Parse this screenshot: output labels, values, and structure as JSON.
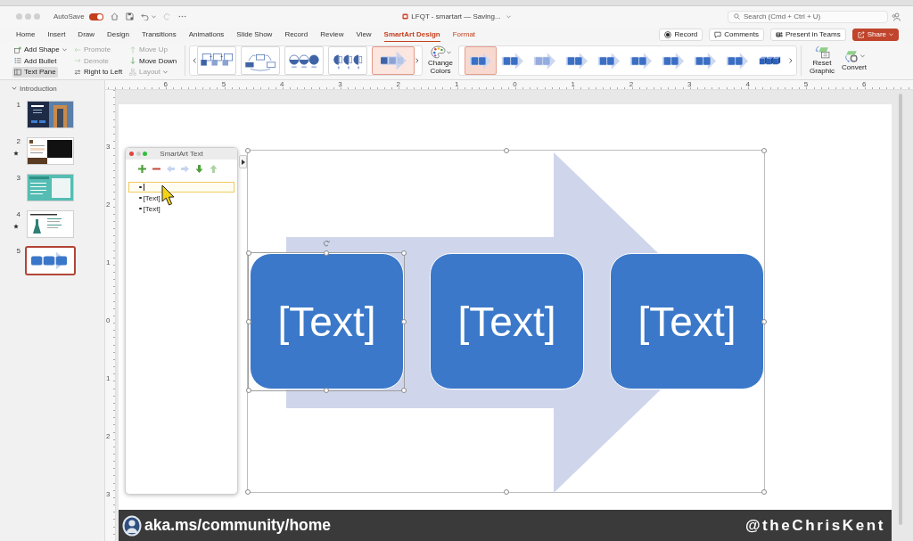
{
  "window": {
    "title": "LFQT - smartart — Saving...",
    "autosave": {
      "label": "AutoSave",
      "on": true
    },
    "search": {
      "placeholder": "Search (Cmd + Ctrl + U)"
    }
  },
  "tabs": [
    {
      "label": "Home",
      "selected": false,
      "contextual": false
    },
    {
      "label": "Insert",
      "selected": false,
      "contextual": false
    },
    {
      "label": "Draw",
      "selected": false,
      "contextual": false
    },
    {
      "label": "Design",
      "selected": false,
      "contextual": false
    },
    {
      "label": "Transitions",
      "selected": false,
      "contextual": false
    },
    {
      "label": "Animations",
      "selected": false,
      "contextual": false
    },
    {
      "label": "Slide Show",
      "selected": false,
      "contextual": false
    },
    {
      "label": "Record",
      "selected": false,
      "contextual": false
    },
    {
      "label": "Review",
      "selected": false,
      "contextual": false
    },
    {
      "label": "View",
      "selected": false,
      "contextual": false
    },
    {
      "label": "SmartArt Design",
      "selected": true,
      "contextual": true
    },
    {
      "label": "Format",
      "selected": false,
      "contextual": true
    }
  ],
  "header_buttons": [
    {
      "label": "Record",
      "kind": "record",
      "dropdown": false
    },
    {
      "label": "Comments",
      "kind": "comments",
      "dropdown": false
    },
    {
      "label": "Present in Teams",
      "kind": "teams",
      "dropdown": false
    },
    {
      "label": "Share",
      "kind": "share",
      "dropdown": true
    }
  ],
  "ribbon": {
    "commands": [
      {
        "label": "Add Shape",
        "kind": "add-shape",
        "disabled": false,
        "on": false,
        "dropdown": true
      },
      {
        "label": "Add Bullet",
        "kind": "add-bullet",
        "disabled": false,
        "on": false,
        "dropdown": false
      },
      {
        "label": "Text Pane",
        "kind": "text-pane",
        "disabled": false,
        "on": true,
        "dropdown": false
      },
      {
        "label": "Promote",
        "kind": "promote",
        "disabled": true,
        "on": false,
        "dropdown": false
      },
      {
        "label": "Demote",
        "kind": "demote",
        "disabled": true,
        "on": false,
        "dropdown": false
      },
      {
        "label": "Right to Left",
        "kind": "right-to-left",
        "disabled": false,
        "on": false,
        "dropdown": false
      },
      {
        "label": "Move Up",
        "kind": "move-up",
        "disabled": true,
        "on": false,
        "dropdown": false
      },
      {
        "label": "Move Down",
        "kind": "move-down",
        "disabled": false,
        "on": false,
        "dropdown": false
      },
      {
        "label": "Layout",
        "kind": "layout",
        "disabled": true,
        "on": false,
        "dropdown": true
      }
    ],
    "layouts": [
      {
        "kind": "process",
        "selected": false
      },
      {
        "kind": "arc",
        "selected": false
      },
      {
        "kind": "circles",
        "selected": false
      },
      {
        "kind": "half-circles",
        "selected": false
      },
      {
        "kind": "arrow-process",
        "selected": true
      }
    ],
    "change_colors": {
      "label": "Change Colors"
    },
    "styles": [
      {
        "kind": "flat",
        "selected": true
      },
      {
        "kind": "flat",
        "selected": false
      },
      {
        "kind": "faded",
        "selected": false
      },
      {
        "kind": "flat",
        "selected": false
      },
      {
        "kind": "flat",
        "selected": false
      },
      {
        "kind": "flat",
        "selected": false
      },
      {
        "kind": "flat",
        "selected": false
      },
      {
        "kind": "flat",
        "selected": false
      },
      {
        "kind": "flat",
        "selected": false
      },
      {
        "kind": "cubes",
        "selected": false
      }
    ],
    "actions": [
      {
        "label": "Reset Graphic",
        "kind": "reset",
        "dropdown": false
      },
      {
        "label": "Convert",
        "kind": "convert",
        "dropdown": true
      }
    ]
  },
  "slide_panel": {
    "section": {
      "label": "Introduction",
      "expanded": true
    },
    "slides": [
      {
        "number": "1",
        "kind": "title-photo",
        "animated": false,
        "selected": false
      },
      {
        "number": "2",
        "kind": "video",
        "animated": true,
        "selected": false
      },
      {
        "number": "3",
        "kind": "teal-list",
        "animated": false,
        "selected": false
      },
      {
        "number": "4",
        "kind": "text-list",
        "animated": true,
        "selected": false
      },
      {
        "number": "5",
        "kind": "smartart",
        "animated": false,
        "selected": true
      }
    ]
  },
  "rulers": {
    "horizontal": [
      "6",
      "5",
      "4",
      "3",
      "2",
      "1",
      "0",
      "1",
      "2",
      "3",
      "4",
      "5",
      "6"
    ],
    "vertical": [
      "3",
      "2",
      "1",
      "0",
      "1",
      "2",
      "3"
    ]
  },
  "slide": {
    "diagram": {
      "selected": true,
      "shapes": [
        {
          "text": "[Text]",
          "selected": true
        },
        {
          "text": "[Text]",
          "selected": false
        },
        {
          "text": "[Text]",
          "selected": false
        }
      ]
    }
  },
  "text_pane": {
    "title": "SmartArt Text",
    "tools": [
      {
        "kind": "add",
        "disabled": false
      },
      {
        "kind": "remove",
        "disabled": false
      },
      {
        "kind": "promote",
        "disabled": true
      },
      {
        "kind": "demote",
        "disabled": true
      },
      {
        "kind": "move-down",
        "disabled": false
      },
      {
        "kind": "move-up",
        "disabled": true
      }
    ],
    "items": [
      {
        "selected": true
      },
      {
        "text": "[Text]",
        "selected": false
      },
      {
        "text": "[Text]",
        "selected": false
      }
    ]
  },
  "banner": {
    "link": "aka.ms/community/home",
    "handle": "@theChrisKent"
  }
}
